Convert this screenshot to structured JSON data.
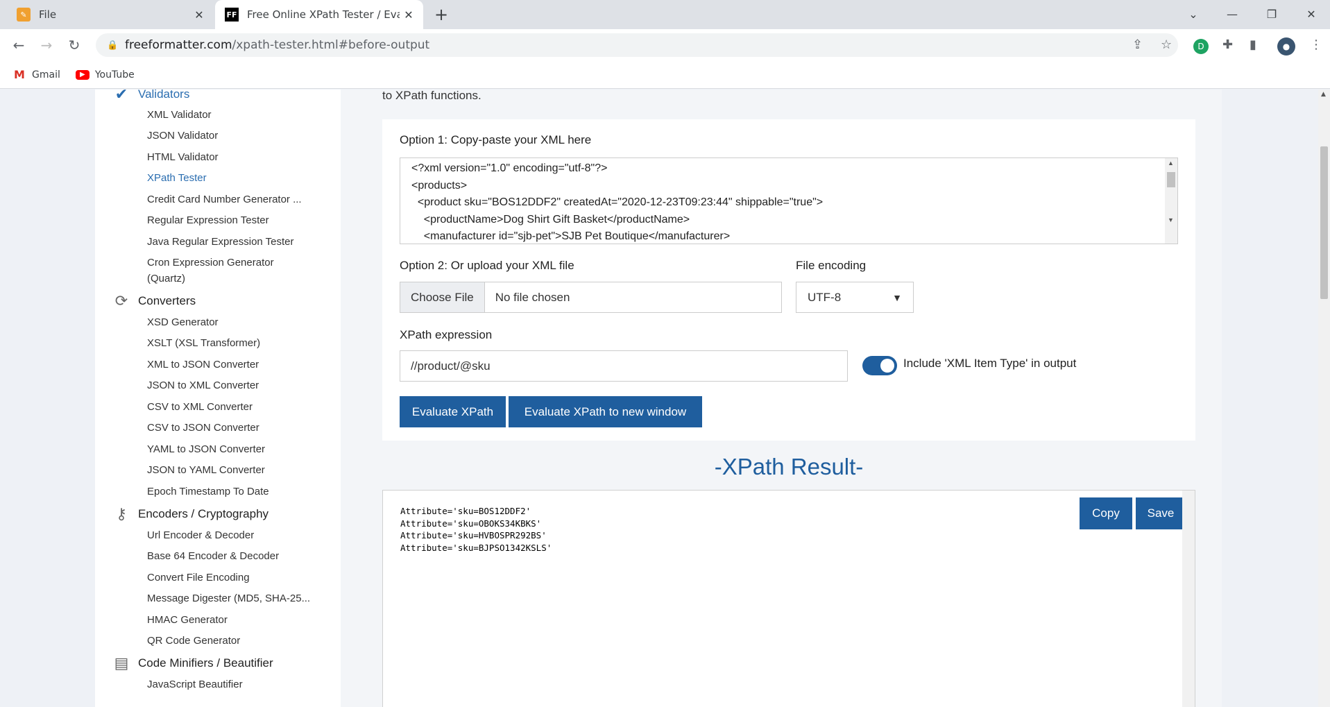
{
  "browser": {
    "tabs": [
      {
        "title": "File",
        "favicon": "file-icon"
      },
      {
        "title": "Free Online XPath Tester / Evalua",
        "favicon": "ff-logo-icon"
      }
    ],
    "url_host": "freeformatter.com",
    "url_path": "/xpath-tester.html#before-output",
    "bookmarks": [
      "Gmail",
      "YouTube"
    ]
  },
  "sidebar": {
    "categories": {
      "validators": "Validators",
      "converters": "Converters",
      "encoders": "Encoders / Cryptography",
      "minifiers": "Code Minifiers / Beautifier"
    },
    "validators": [
      "XML Validator",
      "JSON Validator",
      "HTML Validator",
      "XPath Tester",
      "Credit Card Number Generator ...",
      "Regular Expression Tester",
      "Java Regular Expression Tester",
      "Cron Expression Generator",
      "(Quartz)"
    ],
    "converters": [
      "XSD Generator",
      "XSLT (XSL Transformer)",
      "XML to JSON Converter",
      "JSON to XML Converter",
      "CSV to XML Converter",
      "CSV to JSON Converter",
      "YAML to JSON Converter",
      "JSON to YAML Converter",
      "Epoch Timestamp To Date"
    ],
    "encoders": [
      "Url Encoder & Decoder",
      "Base 64 Encoder & Decoder",
      "Convert File Encoding",
      "Message Digester (MD5, SHA-25...",
      "HMAC Generator",
      "QR Code Generator"
    ],
    "minifiers": [
      "JavaScript Beautifier"
    ]
  },
  "main": {
    "intro_tail": "to XPath functions.",
    "option1_label": "Option 1: Copy-paste your XML here",
    "xml_lines": [
      "<?xml version=\"1.0\" encoding=\"utf-8\"?>",
      "<products>",
      "  <product sku=\"BOS12DDF2\" createdAt=\"2020-12-23T09:23:44\" shippable=\"true\">",
      "    <productName>Dog Shirt Gift Basket</productName>",
      "    <manufacturer id=\"sjb-pet\">SJB Pet Boutique</manufacturer>"
    ],
    "option2_label": "Option 2: Or upload your XML file",
    "choose_file": "Choose File",
    "no_file": "No file chosen",
    "encoding_label": "File encoding",
    "encoding_value": "UTF-8",
    "xpath_label": "XPath expression",
    "xpath_value": "//product/@sku",
    "include_type_label": "Include 'XML Item Type' in output",
    "include_type_on": true,
    "evaluate_btn": "Evaluate XPath",
    "evaluate_new_btn": "Evaluate XPath to new window",
    "result_title": "-XPath Result-",
    "copy_btn": "Copy",
    "save_btn": "Save",
    "result_lines": [
      "Attribute='sku=BOS12DDF2'",
      "Attribute='sku=OBOKS34KBKS'",
      "Attribute='sku=HVBOSPR292BS'",
      "Attribute='sku=BJPSO1342KSLS'"
    ]
  },
  "colors": {
    "accent": "#1f5e9e",
    "link_active": "#2a6db0"
  }
}
